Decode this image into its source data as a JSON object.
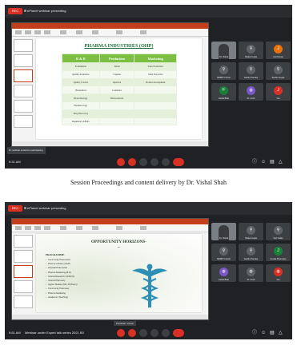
{
  "screens": [
    {
      "meeting_title": "ePlanet webinar presenting",
      "rec_label": "REC",
      "time": "9:31 AM",
      "tooltip": "Dr. webinar ended for participating",
      "slide": {
        "title": "PHARMA INDUSTRIES (OHP)",
        "columns": [
          "R & D",
          "Production",
          "Marketing"
        ],
        "rows": [
          [
            "Formulation",
            "Tablet",
            "Sales Promotion"
          ],
          [
            "Quality Assurance",
            "Capsule",
            "Sales Executive"
          ],
          [
            "Quality Control",
            "Injection",
            "Product development"
          ],
          [
            "Biomedical",
            "Cosmetics",
            ""
          ],
          [
            "Biotechnology",
            "Nutraceuticals",
            ""
          ],
          [
            "Pharmacology",
            "",
            ""
          ],
          [
            "Drug Discovery",
            "",
            ""
          ],
          [
            "Regulatory Affairs",
            "",
            ""
          ]
        ]
      },
      "participants": [
        "Dr. Vishal",
        "Shakti Gupta",
        "Anil Kumar",
        "Dr. Sanjay",
        "Kerala Pharma",
        "Ved Yadav",
        "SIDRP N Ansh",
        "Sachin Pandey",
        "Sachin Gupta",
        "Faizal Bhat",
        "Dr. Ansh",
        "You"
      ],
      "participant_initials": [
        "",
        "",
        "J",
        "",
        "",
        "",
        "",
        "",
        "",
        "F",
        "",
        "J"
      ]
    },
    {
      "meeting_title": "ePlanet webinar presenting",
      "rec_label": "REC",
      "time": "9:51 AM",
      "meeting_name": "Webinar under Expert talk series 2021 B3",
      "presenting_label": "Presenter: screen",
      "slide": {
        "title": "OPPORTUNITY HORIZONS-",
        "subtitle": "...",
        "heading": "PROGRAMME",
        "bullets": [
          "Community Pharmacist",
          "Pharma Industry (OHP)",
          "Hospital Pharmacist",
          "Pharma Marketing (B.D)",
          "Clinical Research (CDSCO)",
          "Clinical Pharmacy",
          "Higher Studies (MS, M.Pharm)",
          "Community Pharmacy",
          "Pharma Marketing",
          "Academic (Teaching)"
        ]
      },
      "participants": [
        "Dr. Vishal",
        "Shakti Gupta",
        "Ved Yadav",
        "SIDRP N Ansh",
        "Sachin Pandey",
        "Kerala Pharmacy",
        "Faizal Bhat",
        "Dr. Ansh",
        "You"
      ],
      "participant_initials": [
        "",
        "",
        "",
        "",
        "",
        "J",
        "",
        "",
        ""
      ]
    }
  ],
  "caption": "Session Proceedings and content delivery by Dr. Vishal Shah",
  "colors": {
    "accent_red": "#d93025",
    "table_header_green": "#7cbf42",
    "title_green": "#1f6f3a"
  },
  "icons": [
    "mic-icon",
    "camera-icon",
    "present-icon",
    "raise-hand-icon",
    "more-icon",
    "end-call-icon",
    "info-icon",
    "people-icon",
    "chat-icon",
    "activities-icon"
  ]
}
